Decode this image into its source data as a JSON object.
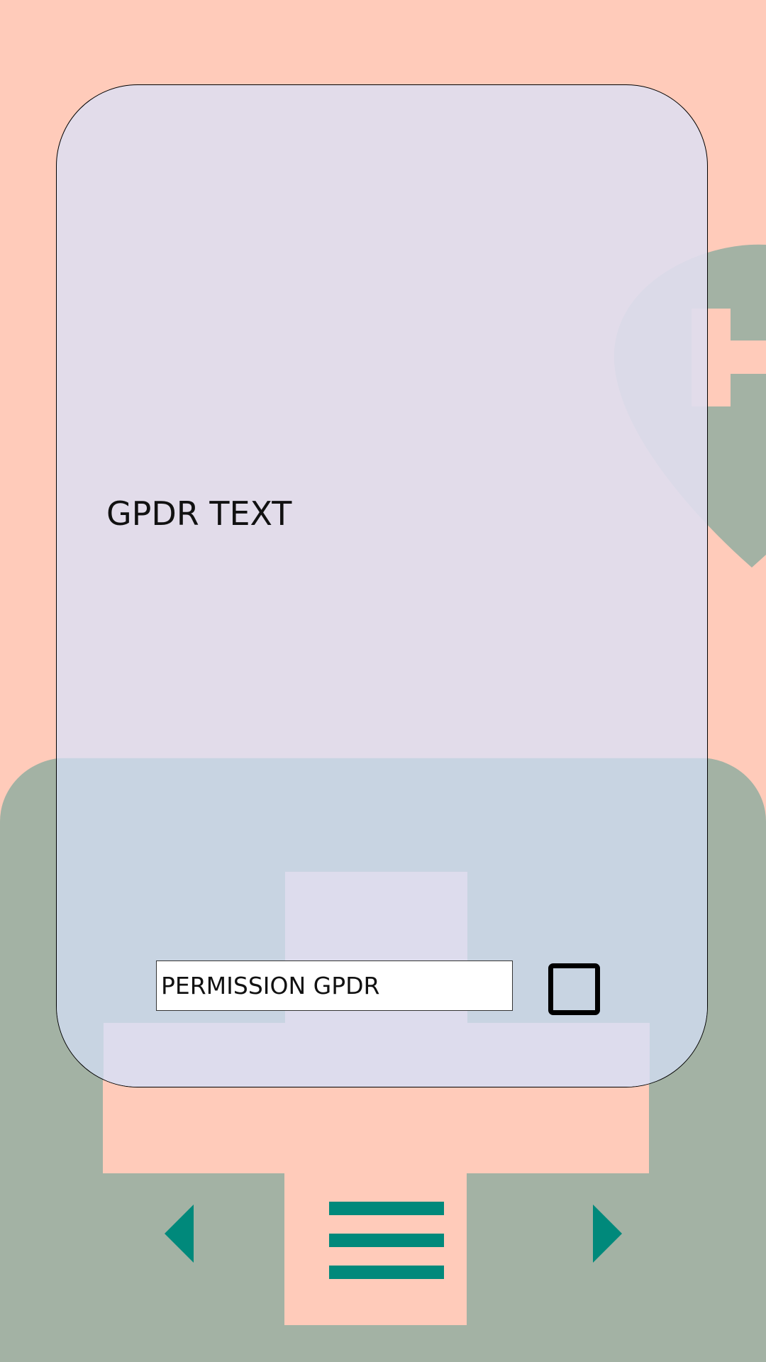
{
  "colors": {
    "background": "#ffcbba",
    "background_shape": "#a3b2a4",
    "card": "#dfddee",
    "card_lower": "#c4d2e0",
    "accent": "#00897b",
    "text": "#111111"
  },
  "dialog": {
    "body_text": "GPDR TEXT"
  },
  "permission": {
    "label": "PERMISSION GPDR",
    "checked": false
  },
  "navigation": {
    "prev_icon": "triangle-left-icon",
    "menu_icon": "hamburger-menu-icon",
    "next_icon": "triangle-right-icon"
  }
}
